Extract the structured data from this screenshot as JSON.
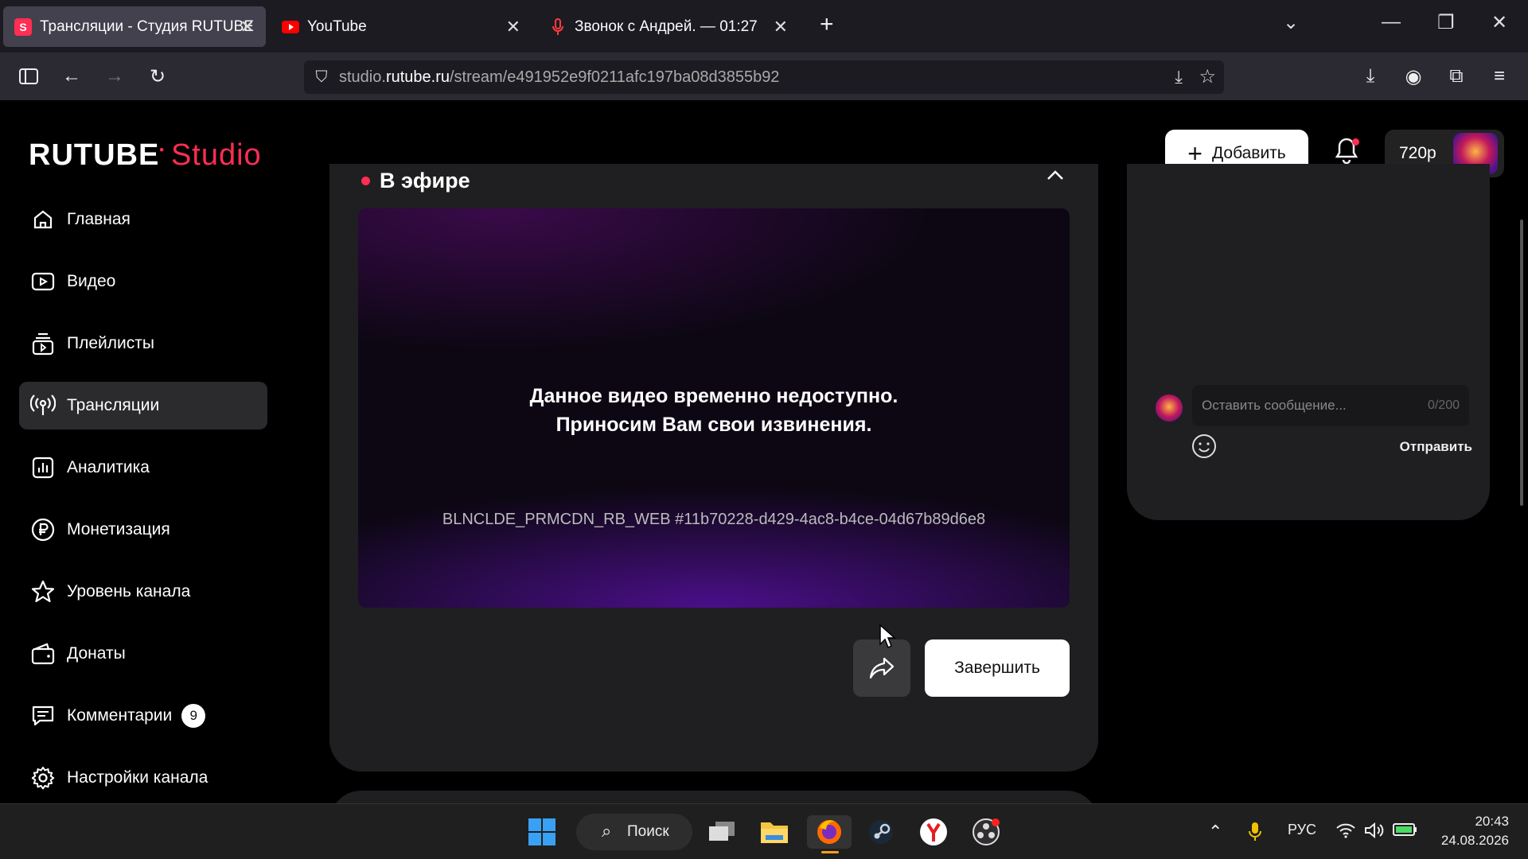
{
  "browser": {
    "tabs": [
      {
        "title": "Трансляции - Студия RUTUBE",
        "active": true,
        "favicon": "rutube-icon"
      },
      {
        "title": "YouTube",
        "active": false,
        "favicon": "youtube-icon"
      },
      {
        "title": "Звонок с Андрей. — 01:27",
        "active": false,
        "favicon": "microphone-icon"
      }
    ],
    "url_prefix": "studio.",
    "url_domain": "rutube.ru",
    "url_path": "/stream/e491952e9f0211afc197ba08d3855b92"
  },
  "header": {
    "logo_main": "RUTUBE",
    "logo_sub": "Studio",
    "add_label": "Добавить",
    "quality": "720p"
  },
  "sidebar": {
    "items": [
      {
        "label": "Главная",
        "icon": "home-icon"
      },
      {
        "label": "Видео",
        "icon": "video-icon"
      },
      {
        "label": "Плейлисты",
        "icon": "playlist-icon"
      },
      {
        "label": "Трансляции",
        "icon": "broadcast-icon",
        "active": true
      },
      {
        "label": "Аналитика",
        "icon": "analytics-icon"
      },
      {
        "label": "Монетизация",
        "icon": "ruble-icon"
      },
      {
        "label": "Уровень канала",
        "icon": "star-icon"
      },
      {
        "label": "Донаты",
        "icon": "wallet-icon"
      },
      {
        "label": "Комментарии",
        "icon": "comment-icon",
        "badge": "9"
      },
      {
        "label": "Настройки канала",
        "icon": "gear-icon"
      }
    ]
  },
  "stream": {
    "status": "В эфире",
    "message_line1": "Данное видео временно недоступно.",
    "message_line2": "Приносим Вам свои извинения.",
    "error_code": "BLNCLDE_PRMCDN_RB_WEB #11b70228-d429-4ac8-b4ce-04d67b89d6e8",
    "end_label": "Завершить"
  },
  "chat": {
    "placeholder": "Оставить сообщение...",
    "counter": "0/200",
    "send_label": "Отправить"
  },
  "taskbar": {
    "search_label": "Поиск",
    "language": "РУС",
    "time": "20:43",
    "date": "24.08.2026"
  },
  "colors": {
    "accent": "#ff2e52",
    "panel": "#1f1f21",
    "active_tab": "#42414d"
  }
}
